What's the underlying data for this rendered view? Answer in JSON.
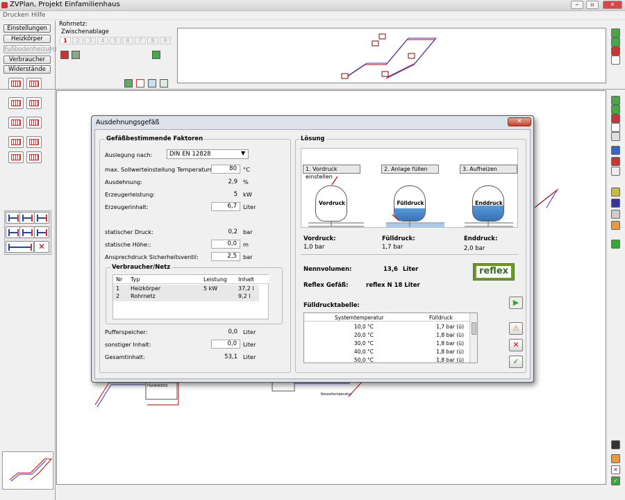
{
  "app": {
    "title": "ZVPlan, Projekt Einfamilienhaus",
    "minimize": "‒",
    "maximize": "▫",
    "close": "✕"
  },
  "menu": [
    "Drucken",
    "Hilfe"
  ],
  "nav": [
    "Einstellungen",
    "Heizkörper",
    "Fußbodenheizung",
    "Verbraucher",
    "Widerstände"
  ],
  "clipboard": {
    "title": "Rohrnetz:",
    "subtitle": "Zwischenablage",
    "pages": [
      "1",
      "2",
      "3",
      "4",
      "5",
      "6",
      "7",
      "8",
      "9"
    ]
  },
  "dialog": {
    "title": "Ausdehnungsgefäß",
    "close": "✕",
    "left_group": "Gefäßbestimmende Faktoren",
    "auslegung_label": "Auslegung nach:",
    "auslegung_value": "DIN EN 12828",
    "rows": [
      {
        "label": "max. Sollwerteinstellung Temperaturregler:",
        "value": "80",
        "unit": "°C",
        "input": true
      },
      {
        "label": "Ausdehnung:",
        "value": "2,9",
        "unit": "%",
        "input": false
      },
      {
        "label": "Erzeugerleistung:",
        "value": "5",
        "unit": "kW",
        "input": false
      },
      {
        "label": "Erzeugerinhalt:",
        "value": "6,7",
        "unit": "Liter",
        "input": true
      },
      {
        "label": "statischer Druck:",
        "value": "0,2",
        "unit": "bar",
        "input": false
      },
      {
        "label": "statische Höhe::",
        "value": "0,0",
        "unit": "m",
        "input": true
      },
      {
        "label": "Ansprechdruck Sicherheitsventil:",
        "value": "2,5",
        "unit": "bar",
        "input": true
      }
    ],
    "consumer_group": "Verbraucher/Netz",
    "consumer_cols": [
      "Nr",
      "Typ",
      "Leistung",
      "Inhalt"
    ],
    "consumers": [
      [
        "1",
        "Heizkörper",
        "5 kW",
        "37,2 l"
      ],
      [
        "2",
        "Rohrnetz",
        "",
        "9,2 l"
      ]
    ],
    "bottom_rows": [
      {
        "label": "Pufferspeicher:",
        "value": "0,0",
        "unit": "Liter",
        "input": false
      },
      {
        "label": "sonstiger Inhalt:",
        "value": "0,0",
        "unit": "Liter",
        "input": true
      },
      {
        "label": "Gesamtinhalt:",
        "value": "53,1",
        "unit": "Liter",
        "input": false
      }
    ],
    "right_group": "Lösung",
    "steps": [
      "1. Vordruck einstellen",
      "2. Anlage füllen",
      "3. Aufheizen"
    ],
    "tanks": [
      "Vordruck",
      "Fülldruck",
      "Enddruck"
    ],
    "results": [
      {
        "label": "Vordruck:",
        "value": "1,0 bar"
      },
      {
        "label": "Fülldruck:",
        "value": "1,7 bar"
      },
      {
        "label": "Enddruck:",
        "value": "2,0 bar"
      }
    ],
    "nennvolumen_label": "Nennvolumen:",
    "nennvolumen_value": "13,6",
    "nennvolumen_unit": "Liter",
    "gefaess_label": "Reflex Gefäß:",
    "gefaess_value": "reflex N 18 Liter",
    "brand": "reflex",
    "table_label": "Fülldrucktabelle:",
    "table_cols": [
      "Systemtemperatur",
      "Fülldruck"
    ],
    "table_rows": [
      [
        "10,0 °C",
        "1,7 bar (ü)"
      ],
      [
        "20,0 °C",
        "1,8 bar (ü)"
      ],
      [
        "30,0 °C",
        "1,8 bar (ü)"
      ],
      [
        "40,0 °C",
        "1,8 bar (ü)"
      ],
      [
        "50,0 °C",
        "1,8 bar (ü)"
      ]
    ]
  },
  "drawing": {
    "label1": "FRAINWERK",
    "label2": "Kesseltemperatur"
  }
}
